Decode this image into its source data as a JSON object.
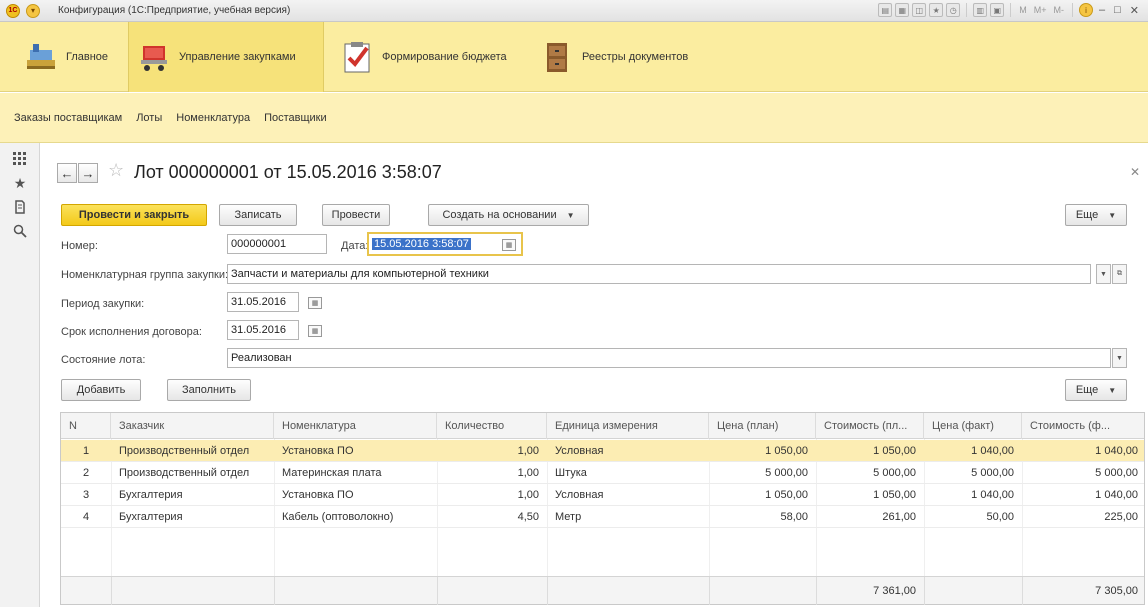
{
  "window": {
    "title": "Конфигурация  (1С:Предприятие, учебная версия)",
    "tb_labels": [
      "M",
      "M+",
      "M-"
    ]
  },
  "sections": [
    {
      "label": "Главное"
    },
    {
      "label": "Управление закупками"
    },
    {
      "label": "Формирование бюджета"
    },
    {
      "label": "Реестры документов"
    }
  ],
  "subnav": [
    "Заказы поставщикам",
    "Лоты",
    "Номенклатура",
    "Поставщики"
  ],
  "form": {
    "title": "Лот 000000001 от 15.05.2016 3:58:07",
    "buttons": {
      "post_close": "Провести и закрыть",
      "save": "Записать",
      "post": "Провести",
      "create_based": "Создать на основании",
      "more": "Еще"
    },
    "fields": {
      "number_label": "Номер:",
      "number_value": "000000001",
      "date_label": "Дата:",
      "date_value": "15.05.2016  3:58:07",
      "group_label": "Номенклатурная группа закупки:",
      "group_value": "Запчасти и материалы для компьютерной техники",
      "period_label": "Период закупки:",
      "period_value": "31.05.2016",
      "deadline_label": "Срок исполнения договора:",
      "deadline_value": "31.05.2016",
      "state_label": "Состояние лота:",
      "state_value": "Реализован"
    },
    "table_buttons": {
      "add": "Добавить",
      "fill": "Заполнить",
      "more": "Еще"
    },
    "table": {
      "headers": [
        "N",
        "Заказчик",
        "Номенклатура",
        "Количество",
        "Единица измерения",
        "Цена (план)",
        "Стоимость (пл...",
        "Цена (факт)",
        "Стоимость (ф..."
      ],
      "rows": [
        {
          "n": "1",
          "customer": "Производственный отдел",
          "item": "Установка ПО",
          "qty": "1,00",
          "unit": "Условная",
          "price_plan": "1 050,00",
          "cost_plan": "1 050,00",
          "price_fact": "1 040,00",
          "cost_fact": "1 040,00"
        },
        {
          "n": "2",
          "customer": "Производственный отдел",
          "item": "Материнская плата",
          "qty": "1,00",
          "unit": "Штука",
          "price_plan": "5 000,00",
          "cost_plan": "5 000,00",
          "price_fact": "5 000,00",
          "cost_fact": "5 000,00"
        },
        {
          "n": "3",
          "customer": "Бухгалтерия",
          "item": "Установка ПО",
          "qty": "1,00",
          "unit": "Условная",
          "price_plan": "1 050,00",
          "cost_plan": "1 050,00",
          "price_fact": "1 040,00",
          "cost_fact": "1 040,00"
        },
        {
          "n": "4",
          "customer": "Бухгалтерия",
          "item": "Кабель (оптоволокно)",
          "qty": "4,50",
          "unit": "Метр",
          "price_plan": "58,00",
          "cost_plan": "261,00",
          "price_fact": "50,00",
          "cost_fact": "225,00"
        }
      ],
      "totals": {
        "cost_plan": "7 361,00",
        "cost_fact": "7 305,00"
      }
    }
  }
}
